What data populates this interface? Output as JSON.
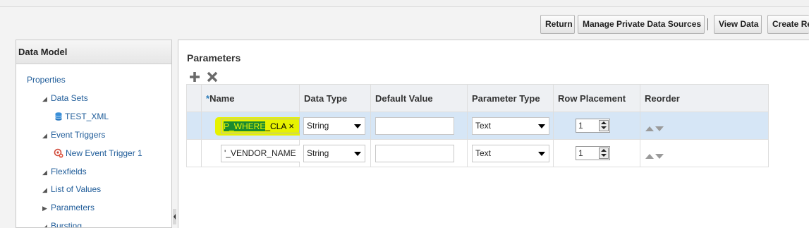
{
  "toolbar": {
    "return": "Return",
    "manage": "Manage Private Data Sources",
    "view_data": "View Data",
    "create": "Create Re"
  },
  "left_panel": {
    "header": "Data Model",
    "items": [
      {
        "label": "Properties"
      },
      {
        "label": "Data Sets",
        "expanded": true
      },
      {
        "label": "TEST_XML",
        "icon": "database-icon"
      },
      {
        "label": "Event Triggers",
        "expanded": true
      },
      {
        "label": "New Event Trigger 1",
        "icon": "event-trigger-icon"
      },
      {
        "label": "Flexfields",
        "expanded": true
      },
      {
        "label": "List of Values",
        "expanded": true
      },
      {
        "label": "Parameters",
        "expanded": false
      },
      {
        "label": "Bursting",
        "expanded": true
      }
    ]
  },
  "main": {
    "title": "Parameters",
    "add_icon": "plus-icon",
    "delete_icon": "close-icon",
    "columns": {
      "name_required": "*",
      "name": "Name",
      "data_type": "Data Type",
      "default_value": "Default Value",
      "parameter_type": "Parameter Type",
      "row_placement": "Row Placement",
      "reorder": "Reorder"
    },
    "rows": [
      {
        "name_selected": "P_WHERE",
        "name_rest": "_CLA",
        "clear": "×",
        "data_type": "String",
        "default_value": "",
        "parameter_type": "Text",
        "row_placement": "1",
        "selected": true
      },
      {
        "name": "'_VENDOR_NAME",
        "data_type": "String",
        "default_value": "",
        "parameter_type": "Text",
        "row_placement": "1",
        "selected": false
      }
    ]
  },
  "colors": {
    "highlight": "#e6f200",
    "selected_row": "#d6e6f6",
    "link": "#1f5c99",
    "text_selection": "#1a8a30"
  }
}
